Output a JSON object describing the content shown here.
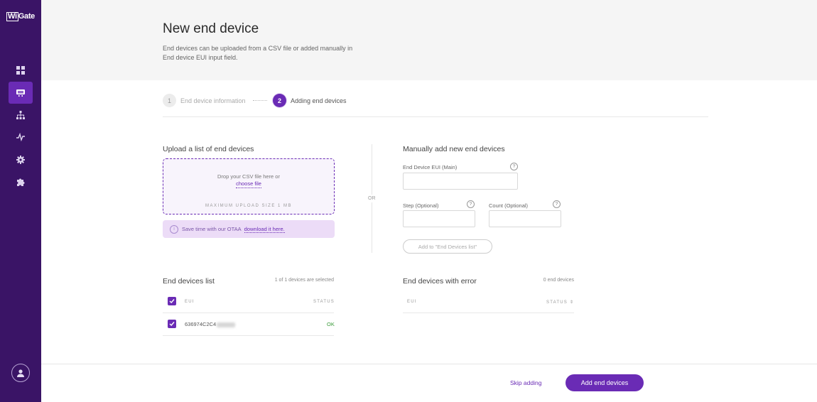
{
  "app": {
    "logo_prefix": "Wi",
    "logo_suffix": "Gate"
  },
  "header": {
    "title": "New end device",
    "description": "End devices can be uploaded from a CSV file or added manually in End device EUI input field."
  },
  "stepper": {
    "steps": [
      {
        "number": "1",
        "label": "End device information"
      },
      {
        "number": "2",
        "label": "Adding end devices"
      }
    ]
  },
  "upload": {
    "title": "Upload a list of end devices",
    "drop_text": "Drop your CSV file here or",
    "choose_file": "choose file",
    "max_size": "MAXIMUM UPLOAD SIZE 1 MB",
    "info_text": "Save time with our OTAA",
    "info_link": "download it here."
  },
  "or_label": "OR",
  "manual": {
    "title": "Manually add new end devices",
    "eui_label": "End Device EUI (Main)",
    "step_label": "Step (Optional)",
    "count_label": "Count (Optional)",
    "help": "?",
    "add_button": "Add to \"End Devices list\""
  },
  "devices_list": {
    "title": "End devices list",
    "count": "1 of 1 devices are selected",
    "col_eui": "EUI",
    "col_status": "STATUS",
    "rows": [
      {
        "eui": "636974C2C4",
        "status": "OK"
      }
    ]
  },
  "errors_list": {
    "title": "End devices with error",
    "count": "0 end devices",
    "col_eui": "EUI",
    "col_status": "STATUS"
  },
  "footer": {
    "skip": "Skip adding",
    "submit": "Add end devices"
  },
  "colors": {
    "sidebar": "#3a1466",
    "accent": "#6a2bb5",
    "status_ok": "#3a9a3a"
  }
}
